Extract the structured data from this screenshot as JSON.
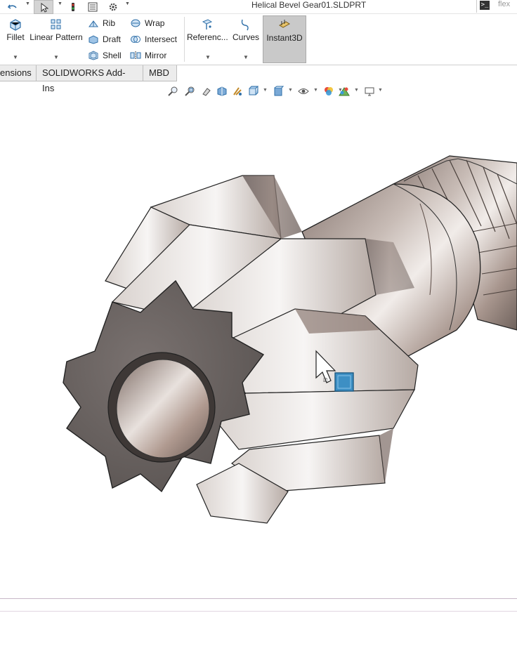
{
  "window": {
    "document_title": "Helical Bevel Gear01.SLDPRT",
    "search_placeholder": "flex"
  },
  "quick_access": [
    {
      "name": "undo-icon"
    },
    {
      "name": "select-icon"
    },
    {
      "name": "rebuild-icon"
    },
    {
      "name": "file-properties-icon"
    },
    {
      "name": "options-gear-icon"
    }
  ],
  "ribbon": {
    "fillet": "Fillet",
    "linear_pattern": "Linear Pattern",
    "rib": "Rib",
    "draft": "Draft",
    "shell": "Shell",
    "wrap": "Wrap",
    "intersect": "Intersect",
    "mirror": "Mirror",
    "reference_geometry": "Referenc...",
    "curves": "Curves",
    "instant3d": "Instant3D"
  },
  "tabs": [
    {
      "label": "ensions"
    },
    {
      "label": "SOLIDWORKS Add-Ins"
    },
    {
      "label": "MBD"
    }
  ],
  "heads_up_toolbar": [
    "zoom-to-fit-icon",
    "zoom-to-area-icon",
    "previous-view-icon",
    "section-view-icon",
    "dynamic-annotation-icon",
    "view-orientation-icon",
    "display-style-icon",
    "hide-show-items-icon",
    "edit-appearance-icon",
    "apply-scene-icon",
    "view-settings-icon"
  ],
  "colors": {
    "accent_blue": "#3d8fc4",
    "gear_dark": "#6e6765",
    "gear_light": "#f2eeec",
    "gear_mid": "#a8968e"
  }
}
